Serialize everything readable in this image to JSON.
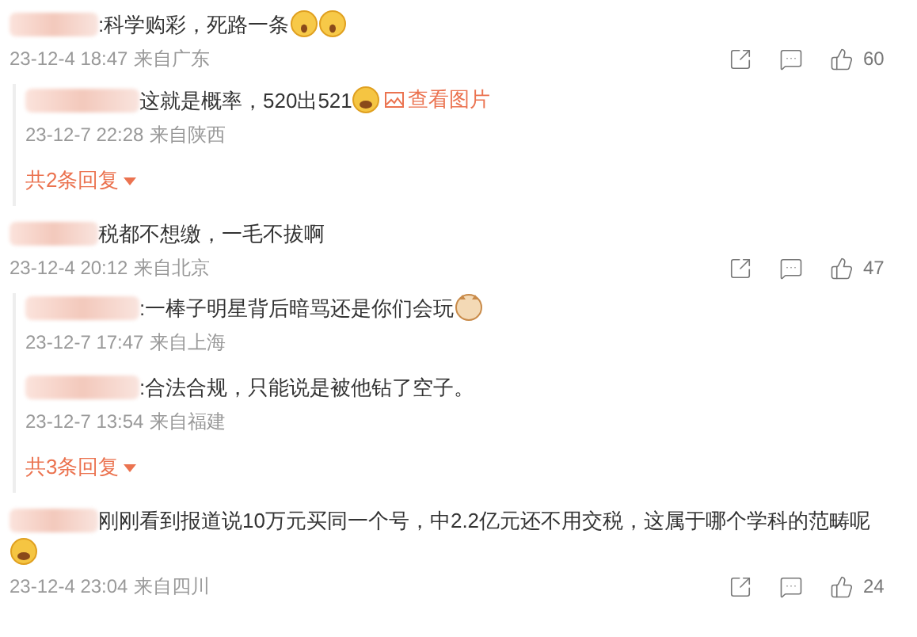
{
  "comments": [
    {
      "text": ":科学购彩，死路一条",
      "emojis": [
        {
          "kind": "scared"
        },
        {
          "kind": "scared"
        }
      ],
      "time": "23-12-4 18:47",
      "location": "来自广东",
      "likes": "60",
      "replies": [
        {
          "text": "这就是概率，520出521",
          "emojis": [
            {
              "kind": "laughing"
            }
          ],
          "link": "查看图片",
          "time": "23-12-7 22:28",
          "location": "来自陕西"
        }
      ],
      "more_replies": "共2条回复"
    },
    {
      "text": "税都不想缴，一毛不拔啊",
      "time": "23-12-4 20:12",
      "location": "来自北京",
      "likes": "47",
      "replies": [
        {
          "text": ":一棒子明星背后暗骂还是你们会玩",
          "emojis": [
            {
              "kind": "cat"
            }
          ],
          "time": "23-12-7 17:47",
          "location": "来自上海"
        },
        {
          "text": ":合法合规，只能说是被他钻了空子。",
          "time": "23-12-7 13:54",
          "location": "来自福建"
        }
      ],
      "more_replies": "共3条回复"
    },
    {
      "text": "刚刚看到报道说10万元买同一个号，中2.2亿元还不用交税，这属于哪个学科的范畴呢",
      "emojis": [
        {
          "kind": "laughing"
        }
      ],
      "time": "23-12-4 23:04",
      "location": "来自四川",
      "likes": "24"
    }
  ]
}
